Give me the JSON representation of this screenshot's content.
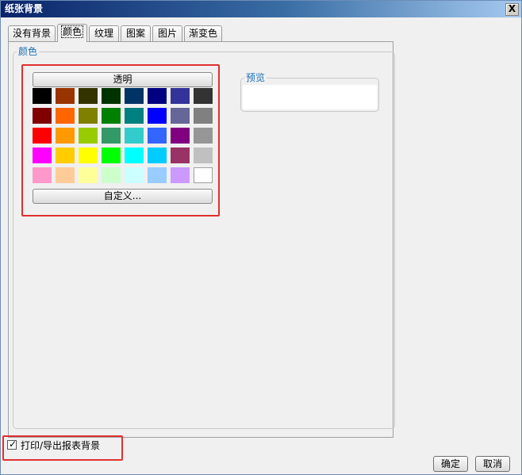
{
  "window": {
    "title": "纸张背景",
    "close_glyph": "X"
  },
  "tabs": [
    {
      "label": "没有背景"
    },
    {
      "label": "颜色",
      "active": true
    },
    {
      "label": "纹理"
    },
    {
      "label": "图案"
    },
    {
      "label": "图片"
    },
    {
      "label": "渐变色"
    }
  ],
  "color_group": {
    "legend": "颜色"
  },
  "palette": {
    "transparent_label": "透明",
    "custom_label": "自定义...",
    "rows": [
      [
        "#000000",
        "#993300",
        "#333300",
        "#003300",
        "#003366",
        "#000080",
        "#333399",
        "#333333"
      ],
      [
        "#800000",
        "#ff6600",
        "#808000",
        "#008000",
        "#008080",
        "#0000ff",
        "#666699",
        "#808080"
      ],
      [
        "#ff0000",
        "#ff9900",
        "#99cc00",
        "#339966",
        "#33cccc",
        "#3366ff",
        "#800080",
        "#969696"
      ],
      [
        "#ff00ff",
        "#ffcc00",
        "#ffff00",
        "#00ff00",
        "#00ffff",
        "#00ccff",
        "#993366",
        "#c0c0c0"
      ],
      [
        "#ff99cc",
        "#ffcc99",
        "#ffff99",
        "#ccffcc",
        "#ccffff",
        "#99ccff",
        "#cc99ff",
        "#ffffff"
      ]
    ]
  },
  "preview": {
    "legend": "预览",
    "color": "#ffffff"
  },
  "print_option": {
    "label": "打印/导出报表背景",
    "checked": true
  },
  "buttons": {
    "ok": "确定",
    "cancel": "取消"
  },
  "accent_color": "#e03030"
}
